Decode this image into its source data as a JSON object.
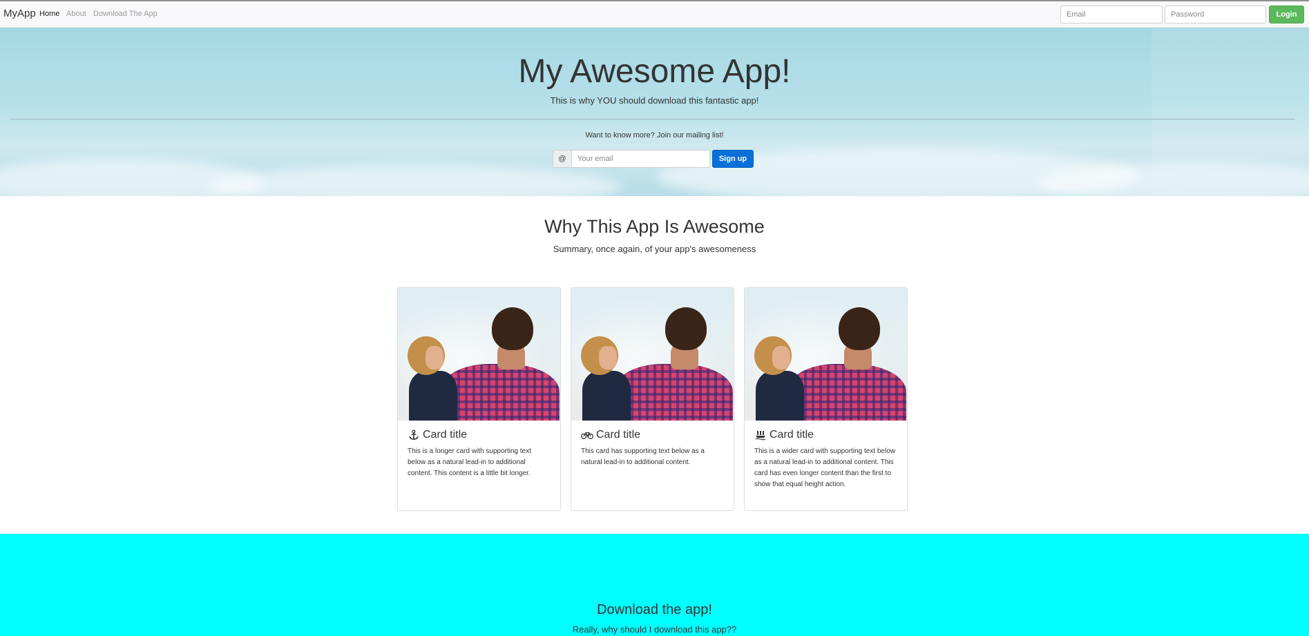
{
  "navbar": {
    "brand": "MyApp",
    "links": [
      "Home",
      "About",
      "Download The App"
    ],
    "email_placeholder": "Email",
    "password_placeholder": "Password",
    "login_label": "Login"
  },
  "hero": {
    "title": "My Awesome App!",
    "subtitle": "This is why YOU should download this fantastic app!",
    "mailing_prompt": "Want to know more? Join our mailing list!",
    "at_symbol": "@",
    "email_placeholder": "Your email",
    "signup_label": "Sign up"
  },
  "features": {
    "title": "Why This App Is Awesome",
    "subtitle": "Summary, once again, of your app's awesomeness",
    "cards": [
      {
        "icon": "anchor-icon",
        "title": "Card title",
        "text": "This is a longer card with supporting text below as a natural lead-in to additional content. This content is a little bit longer."
      },
      {
        "icon": "bicycle-icon",
        "title": "Card title",
        "text": "This card has supporting text below as a natural lead-in to additional content."
      },
      {
        "icon": "ship-icon",
        "title": "Card title",
        "text": "This is a wider card with supporting text below as a natural lead-in to additional content. This card has even longer content than the first to show that equal height action."
      }
    ]
  },
  "download": {
    "title": "Download the app!",
    "subtitle": "Really, why should I download this app??"
  },
  "colors": {
    "login_button": "#5cb85c",
    "signup_button": "#0a6fd6",
    "download_background": "#00ffff"
  }
}
